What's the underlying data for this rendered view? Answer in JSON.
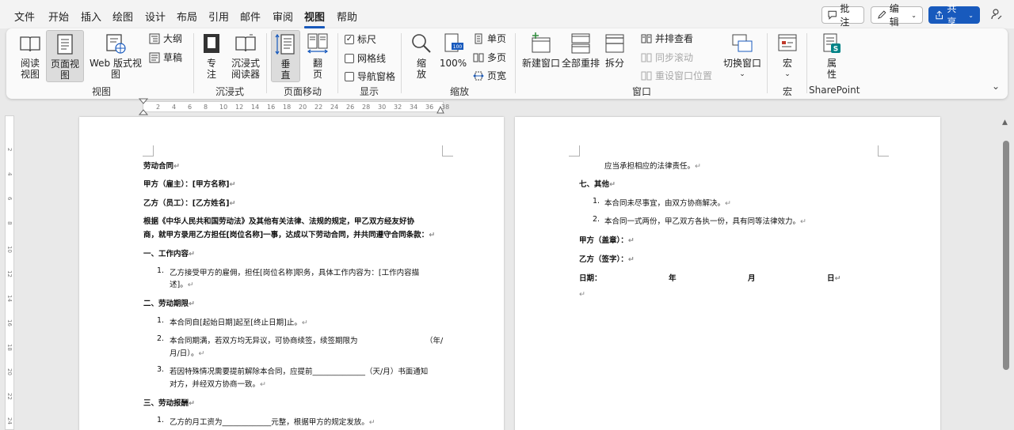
{
  "menu": {
    "items": [
      "文件",
      "开始",
      "插入",
      "绘图",
      "设计",
      "布局",
      "引用",
      "邮件",
      "审阅",
      "视图",
      "帮助"
    ],
    "active": "视图",
    "comments_label": "批注",
    "editing_label": "编辑",
    "share_label": "共享"
  },
  "ribbon": {
    "views": {
      "read_mode": "阅读\n视图",
      "print_layout": "页面视图",
      "web_layout": "Web 版式视图",
      "outline": "大纲",
      "draft": "草稿",
      "label": "视图"
    },
    "immersive": {
      "focus": "专\n注",
      "immersive_reader": "沉浸式\n阅读器",
      "label": "沉浸式"
    },
    "page_movement": {
      "vertical": "垂\n直",
      "side_to_side": "翻\n页",
      "label": "页面移动"
    },
    "show": {
      "ruler": "标尺",
      "gridlines": "网格线",
      "nav_pane": "导航窗格",
      "ruler_checked": true,
      "gridlines_checked": false,
      "nav_pane_checked": false,
      "label": "显示"
    },
    "zoom": {
      "zoom": "缩\n放",
      "hundred": "100%",
      "one_page": "单页",
      "multiple_pages": "多页",
      "page_width": "页宽",
      "label": "缩放"
    },
    "window": {
      "new_window": "新建窗口",
      "arrange_all": "全部重排",
      "split": "拆分",
      "side_by_side": "并排查看",
      "sync_scroll": "同步滚动",
      "reset_position": "重设窗口位置",
      "switch_windows": "切换窗口",
      "label": "窗口"
    },
    "macros": {
      "macros": "宏",
      "label": "宏"
    },
    "sharepoint": {
      "properties": "属\n性",
      "label": "SharePoint"
    }
  },
  "ruler": {
    "ticks": [
      "2",
      "4",
      "6",
      "8",
      "10",
      "12",
      "14",
      "16",
      "18",
      "20",
      "22",
      "24",
      "26",
      "28",
      "30",
      "32",
      "34",
      "36",
      "38"
    ]
  },
  "vruler": {
    "ticks": [
      "2",
      "4",
      "6",
      "8",
      "10",
      "12",
      "14",
      "16",
      "18",
      "20",
      "22",
      "24"
    ]
  },
  "page1": {
    "title": "劳动合同",
    "party_a": "甲方（雇主）：[甲方名称]",
    "party_b": "乙方（员工）：[乙方姓名]",
    "intro_1": "根据《中华人民共和国劳动法》及其他有关法律、法规的规定，甲乙双方经友好协",
    "intro_2": "商，就甲方录用乙方担任[岗位名称]一事，达成以下劳动合同，并共同遵守合同条款：",
    "s1": "一、工作内容",
    "s1_i1a": "乙方接受甲方的雇佣，担任[岗位名称]职务，具体工作内容为：[工作内容描",
    "s1_i1b": "述]。",
    "s2": "二、劳动期限",
    "s2_i1": "本合同自[起始日期]起至[终止日期]止。",
    "s2_i2a": "本合同期满，若双方均无异议，可协商续签，续签期限为",
    "s2_i2a_tail": "（年/",
    "s2_i2b": "月/日）。",
    "s2_i3a": "若因特殊情况需要提前解除本合同，应提前______________（天/月）书面通知",
    "s2_i3b": "对方，并经双方协商一致。",
    "s3": "三、劳动报酬",
    "s3_i1": "乙方的月工资为_____________元整，根据甲方的规定发放。"
  },
  "page2": {
    "l1": "应当承担相应的法律责任。",
    "s7": "七、其他",
    "i1": "本合同未尽事宜，由双方协商解决。",
    "i2": "本合同一式两份，甲乙双方各执一份，具有同等法律效力。",
    "party_a_sign": "甲方（盖章）：",
    "party_b_sign": "乙方（签字）：",
    "date": "日期：",
    "year": "年",
    "month": "月",
    "day": "日"
  }
}
